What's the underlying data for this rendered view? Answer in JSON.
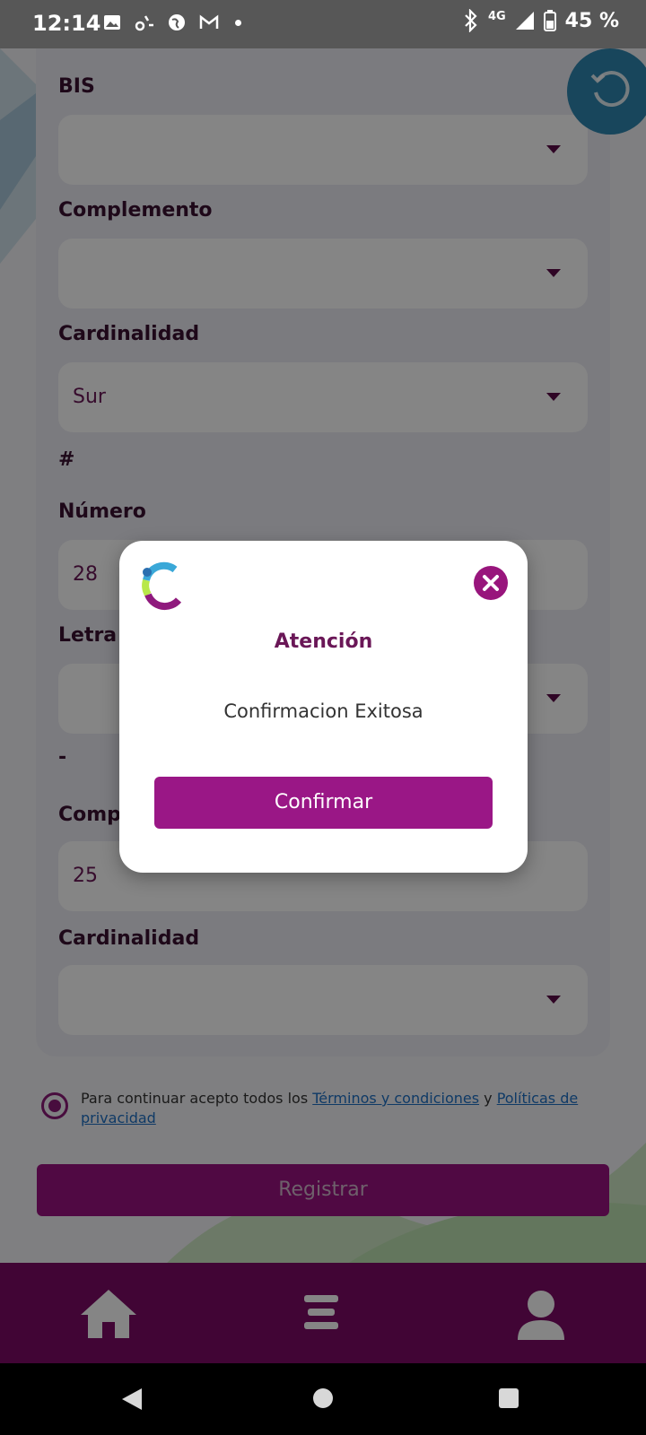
{
  "status_bar": {
    "time": "12:14",
    "network": "4G",
    "battery": "45 %"
  },
  "form": {
    "fields": [
      {
        "label": "BIS",
        "value": ""
      },
      {
        "label": "Complemento",
        "value": ""
      },
      {
        "label": "Cardinalidad",
        "value": "Sur"
      },
      {
        "label": "#"
      },
      {
        "label": "Número",
        "value": "28"
      },
      {
        "label": "Letra",
        "value": ""
      },
      {
        "label": "-"
      },
      {
        "label": "Comp",
        "value": "25"
      },
      {
        "label": "Cardinalidad",
        "value": ""
      }
    ]
  },
  "terms": {
    "prefix": "Para continuar acepto todos los ",
    "terms_link": "Términos y condiciones",
    "connector": " y ",
    "privacy_link": "Políticas de privacidad"
  },
  "register_label": "Registrar",
  "dialog": {
    "title": "Atención",
    "message": "Confirmacion Exitosa",
    "confirm_label": "Confirmar"
  },
  "colors": {
    "brand_purple": "#9a1786",
    "nav_purple": "#7e0b66",
    "refresh_blue": "#2f86b0",
    "link_blue": "#1e6fc4"
  },
  "icons": {
    "nav": [
      "home-icon",
      "menu-icon",
      "user-icon"
    ],
    "dialog_close": "close-icon",
    "refresh": "refresh-icon"
  }
}
